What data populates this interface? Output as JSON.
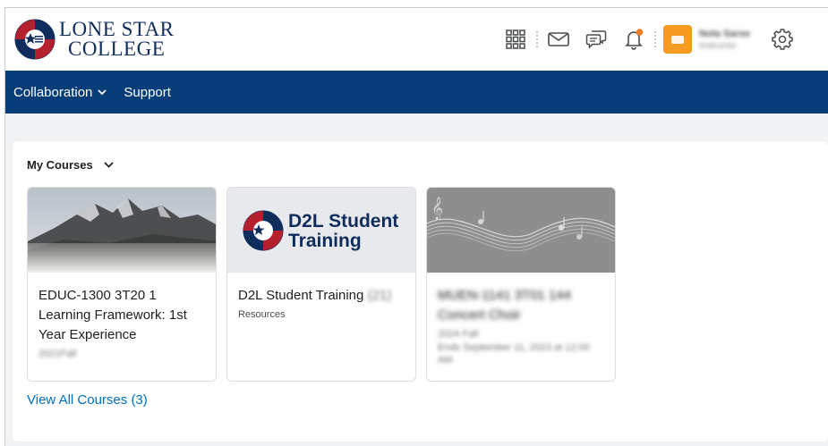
{
  "header": {
    "logo_line1": "LONE STAR",
    "logo_line2": "COLLEGE",
    "user_name": "Nola Sarse",
    "user_role": "Instructor"
  },
  "nav": {
    "items": [
      {
        "label": "Collaboration"
      },
      {
        "label": "Support"
      }
    ]
  },
  "widget": {
    "title": "My Courses",
    "view_all": "View All Courses (3)"
  },
  "courses": [
    {
      "title": "EDUC-1300 3T20 1 Learning Framework: 1st Year Experience",
      "subtitle": "2021Fall"
    },
    {
      "title": "D2L Student Training",
      "title_suffix": "(21)",
      "subtitle": "Resources",
      "banner_line1": "D2L Student",
      "banner_line2": "Training"
    },
    {
      "title": "MUEN-1141 3T01 144 Concert Choir",
      "subtitle": "2024 Fall",
      "ends": "Ends September 11, 2023 at 12:00 AM"
    }
  ],
  "colors": {
    "navbar": "#073e7a",
    "link": "#006fbf",
    "notify_dot": "#f07c22",
    "avatar": "#f59a23"
  }
}
